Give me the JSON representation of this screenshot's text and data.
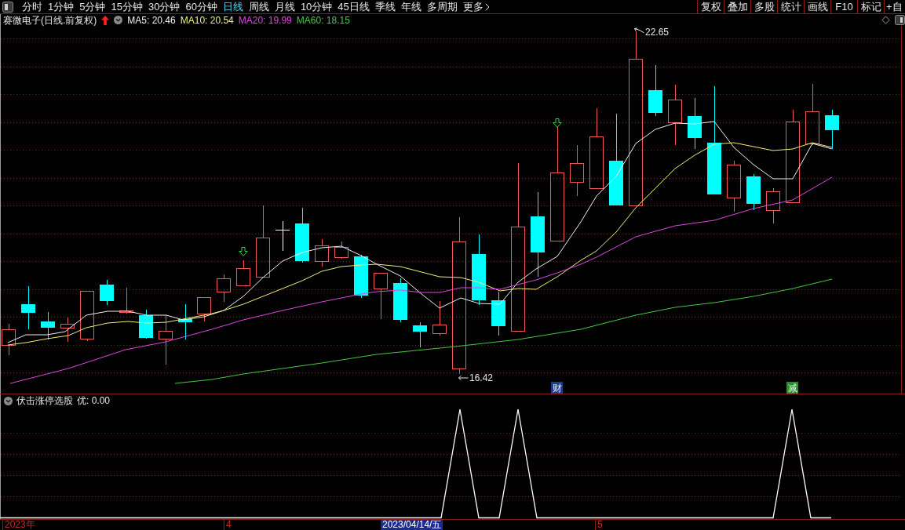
{
  "toolbar": {
    "periods": [
      {
        "label": "分时",
        "selected": false
      },
      {
        "label": "1分钟",
        "selected": false
      },
      {
        "label": "5分钟",
        "selected": false
      },
      {
        "label": "15分钟",
        "selected": false
      },
      {
        "label": "30分钟",
        "selected": false
      },
      {
        "label": "60分钟",
        "selected": false
      },
      {
        "label": "日线",
        "selected": true
      },
      {
        "label": "周线",
        "selected": false
      },
      {
        "label": "月线",
        "selected": false
      },
      {
        "label": "10分钟",
        "selected": false
      },
      {
        "label": "45日线",
        "selected": false
      },
      {
        "label": "季线",
        "selected": false
      },
      {
        "label": "年线",
        "selected": false
      },
      {
        "label": "多周期",
        "selected": false
      }
    ],
    "more": "更多",
    "buttons": [
      "复权",
      "叠加",
      "多股",
      "统计",
      "画线",
      "F10",
      "标记",
      "+自"
    ]
  },
  "info_bar": {
    "title": "赛微电子(日线.前复权)",
    "moving_averages": [
      {
        "label": "MA5: 20.46",
        "color": "#f0f0f0"
      },
      {
        "label": "MA10: 20.54",
        "color": "#f2ee7a"
      },
      {
        "label": "MA20: 19.99",
        "color": "#e048e0"
      },
      {
        "label": "MA60: 18.15",
        "color": "#48c848"
      }
    ]
  },
  "main_chart": {
    "high_label": "22.65",
    "low_label": "16.42",
    "event_tags": [
      {
        "label": "财",
        "color": "#1e3c8c"
      },
      {
        "label": "减",
        "color": "#2e8a2e"
      }
    ]
  },
  "indicator_panel": {
    "title": "伏击涨停选股",
    "value": "优: 0.00"
  },
  "time_axis": [
    {
      "label": "2023年",
      "selected": false
    },
    {
      "label": "4",
      "selected": false
    },
    {
      "label": "2023/04/14/五",
      "selected": true
    },
    {
      "label": "5",
      "selected": false
    }
  ]
}
